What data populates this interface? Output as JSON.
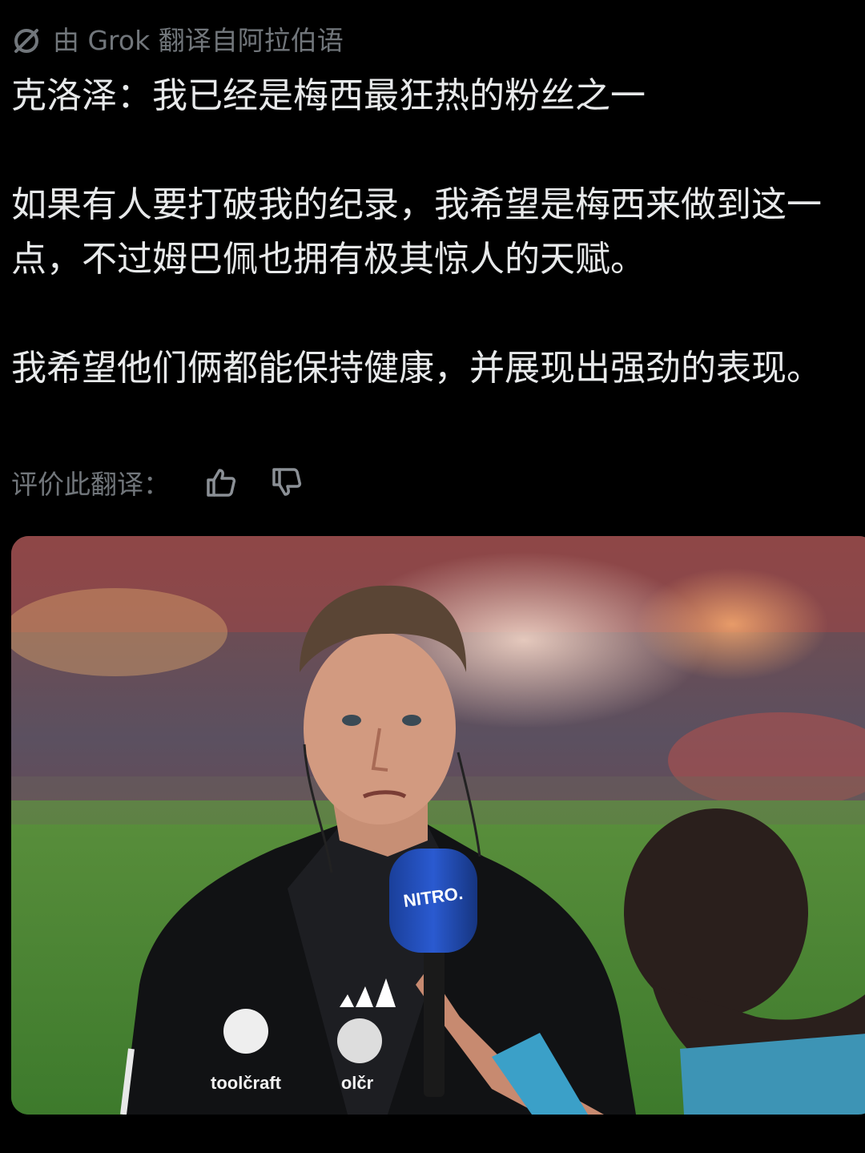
{
  "translation": {
    "label": "由 Grok 翻译自阿拉伯语",
    "icon": "grok-icon"
  },
  "post": {
    "paragraphs": [
      "克洛泽：我已经是梅西最狂热的粉丝之一",
      "如果有人要打破我的纪录，我希望是梅西来做到这一点，不过姆巴佩也拥有极其惊人的天赋。",
      "我希望他们俩都能保持健康，并展现出强劲的表现。"
    ]
  },
  "rating": {
    "label": "评价此翻译：",
    "thumbs_up_icon": "thumbs-up-icon",
    "thumbs_down_icon": "thumbs-down-icon"
  },
  "media": {
    "mic_brand": "NITRO.",
    "jacket_sponsor": "toolčraft",
    "shirt_sponsor": "olčr"
  },
  "colors": {
    "background": "#000000",
    "text": "#e7e9ea",
    "muted": "#71767b"
  }
}
